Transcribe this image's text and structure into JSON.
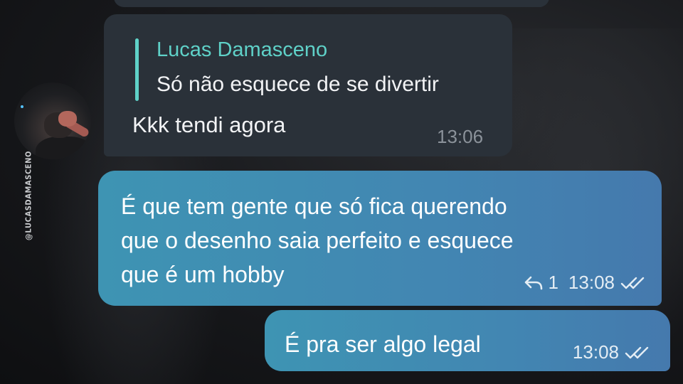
{
  "watermark": "@LUCASDAMASCENO",
  "incoming": {
    "quote_author": "Lucas Damasceno",
    "quote_text": "Só não esquece de se divertir",
    "text": "Kkk tendi agora",
    "time": "13:06"
  },
  "outgoing": [
    {
      "lines": [
        "É que tem gente que só fica querendo",
        "que o desenho saia perfeito e esquece",
        "que é um hobby"
      ],
      "reply_count": "1",
      "time": "13:08",
      "status_icon": "double-check-icon"
    },
    {
      "text": "É pra ser algo legal",
      "time": "13:08",
      "status_icon": "double-check-icon"
    }
  ],
  "colors": {
    "incoming_bubble": "#2a3139",
    "quote_accent": "#5fd1c8",
    "outgoing_gradient_start": "#3e94b3",
    "outgoing_gradient_end": "#4579ad"
  }
}
